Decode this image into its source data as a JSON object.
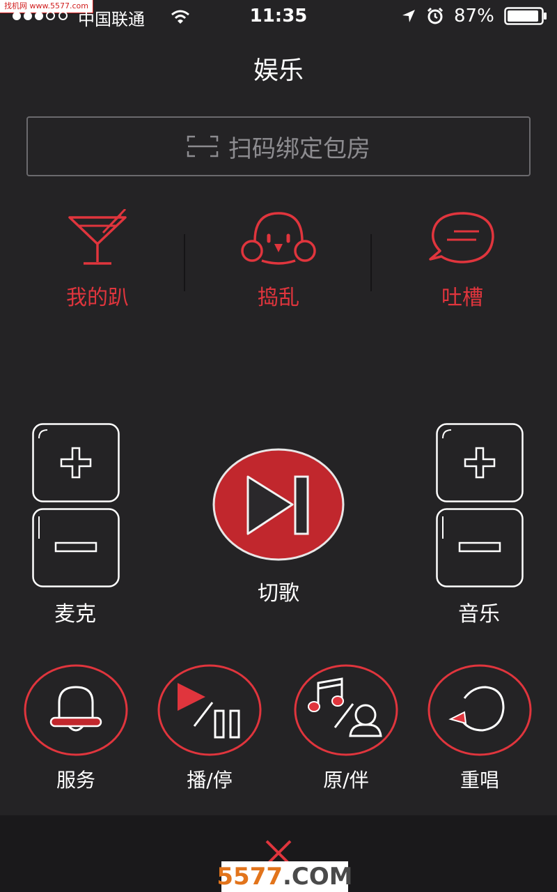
{
  "watermark_top": "找机网 www.5577.com",
  "status_bar": {
    "carrier": "中国联通",
    "time": "11:35",
    "battery": "87%"
  },
  "header": {
    "title": "娱乐"
  },
  "scan_button": {
    "label": "扫码绑定包房",
    "icon": "scan-icon"
  },
  "features": [
    {
      "label": "我的趴",
      "icon": "cocktail-icon"
    },
    {
      "label": "捣乱",
      "icon": "mischief-face-icon"
    },
    {
      "label": "吐槽",
      "icon": "chat-bubble-icon"
    }
  ],
  "controls": {
    "mic_label": "麦克",
    "music_label": "音乐",
    "cut_song_label": "切歌"
  },
  "bottom_buttons": [
    {
      "label": "服务",
      "icon": "bell-icon"
    },
    {
      "label": "播/停",
      "icon": "play-pause-icon"
    },
    {
      "label": "原/伴",
      "icon": "original-accompany-icon"
    },
    {
      "label": "重唱",
      "icon": "replay-icon"
    }
  ],
  "close_icon": "close-icon",
  "watermark_bottom": {
    "num": "5577",
    "dot_com": ".COM"
  },
  "colors": {
    "accent": "#e0353d",
    "background": "#242325",
    "cut_button": "#c1272d"
  }
}
